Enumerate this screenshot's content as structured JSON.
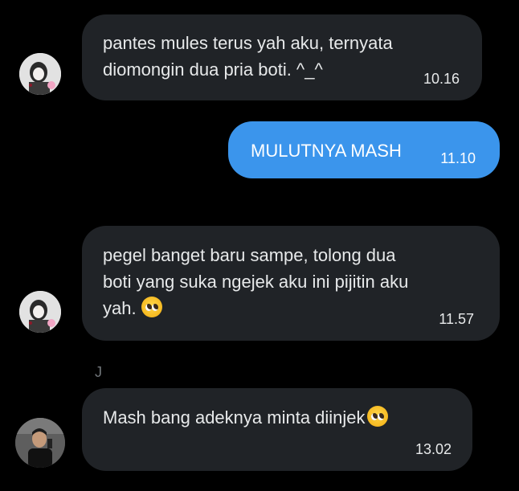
{
  "messages": [
    {
      "text_line1": "pantes mules terus yah aku, ternyata",
      "text_line2": "diomongin dua pria boti. ^_^",
      "time": "10.16"
    },
    {
      "text": "MULUTNYA MASH",
      "time": "11.10"
    },
    {
      "text_line1": "pegel banget baru sampe, tolong dua",
      "text_line2": "boti yang suka ngejek aku ini pijitin aku",
      "text_line3": "yah.",
      "emoji": "pleading-face",
      "time": "11.57"
    },
    {
      "sender_initial": "J",
      "text": "Mash bang adeknya minta diinjek",
      "emoji": "pleading-face",
      "time": "13.02"
    }
  ],
  "colors": {
    "background": "#000000",
    "incoming_bubble": "#202327",
    "outgoing_bubble": "#3b95ec",
    "text": "#e7e9ea",
    "muted": "#71767b"
  }
}
